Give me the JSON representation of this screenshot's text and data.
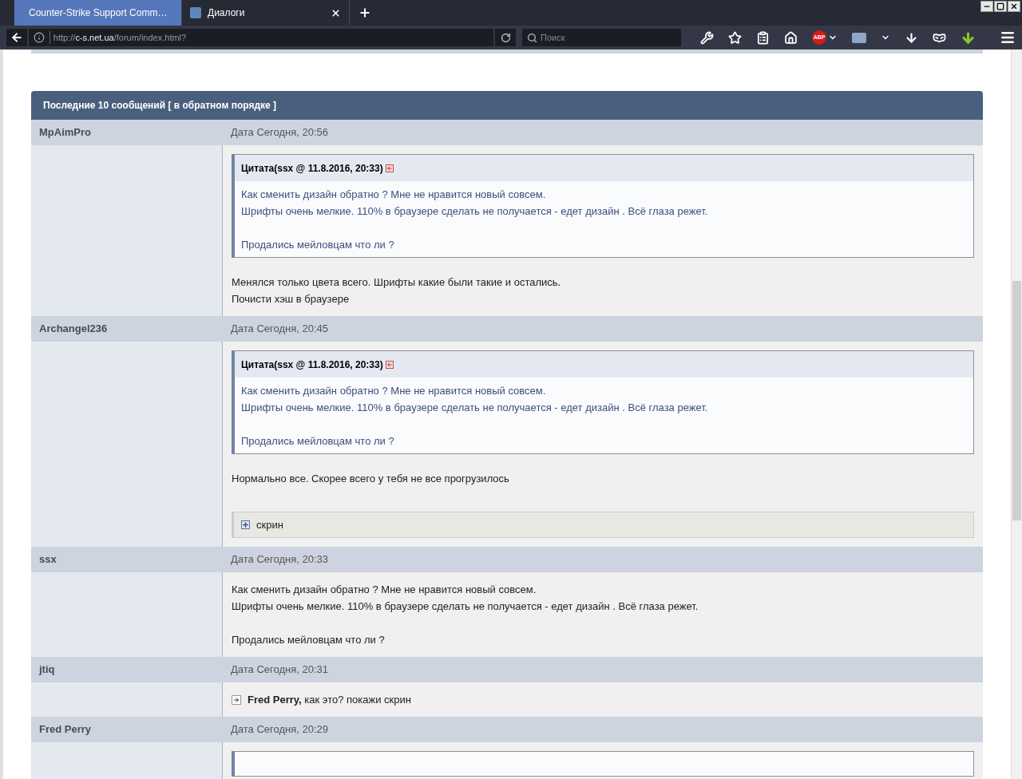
{
  "tabs": [
    {
      "label": "Counter-Strike Support Comm…",
      "selected": true
    },
    {
      "label": "Диалоги",
      "selected": false
    }
  ],
  "address": {
    "host": "c-s.net.ua",
    "scheme": "http://",
    "path": "/forum/index.html?"
  },
  "search": {
    "placeholder": "Поиск"
  },
  "adblock_badge": "ABP",
  "section_title": "Последние 10 сообщений [ в обратном порядке ]",
  "posts": [
    {
      "author": "MpAimPro",
      "date": "Дата Сегодня, 20:56",
      "blocks": [
        {
          "kind": "quote",
          "header": "Цитата(ssx @ 11.8.2016, 20:33)",
          "paragraphs": [
            [
              "Как сменить дизайн обратно ? Мне не нравится новый совсем.",
              "Шрифты очень мелкие. 110% в браузере сделать не получается - едет дизайн . Всё глаза режет."
            ],
            [
              "Продались мейловцам что ли ?"
            ]
          ]
        },
        {
          "kind": "text",
          "paragraphs": [
            [
              "Менялся только цвета всего. Шрифты какие были такие и остались.",
              "Почисти хэш в браузере"
            ]
          ]
        }
      ]
    },
    {
      "author": "Archangel236",
      "date": "Дата Сегодня, 20:45",
      "blocks": [
        {
          "kind": "quote",
          "header": "Цитата(ssx @ 11.8.2016, 20:33)",
          "paragraphs": [
            [
              "Как сменить дизайн обратно ? Мне не нравится новый совсем.",
              "Шрифты очень мелкие. 110% в браузере сделать не получается - едет дизайн . Всё глаза режет."
            ],
            [
              "Продались мейловцам что ли ?"
            ]
          ]
        },
        {
          "kind": "text",
          "paragraphs": [
            [
              "Нормально все. Скорее всего у тебя не все прогрузилось"
            ]
          ]
        },
        {
          "kind": "spoiler",
          "label": "скрин",
          "expanded": false
        }
      ]
    },
    {
      "author": "ssx",
      "date": "Дата Сегодня, 20:33",
      "blocks": [
        {
          "kind": "text",
          "paragraphs": [
            [
              "Как сменить дизайн обратно ? Мне не нравится новый совсем.",
              "Шрифты очень мелкие. 110% в браузере сделать не получается - едет дизайн . Всё глаза режет."
            ],
            [
              "Продались мейловцам что ли ?"
            ]
          ]
        }
      ]
    },
    {
      "author": "jtiq",
      "date": "Дата Сегодня, 20:31",
      "blocks": [
        {
          "kind": "mention",
          "name": "Fred Perry,",
          "text": "как это? покажи скрин"
        }
      ]
    },
    {
      "author": "Fred Perry",
      "date": "Дата Сегодня, 20:29",
      "blocks": [
        {
          "kind": "quote"
        }
      ]
    }
  ]
}
